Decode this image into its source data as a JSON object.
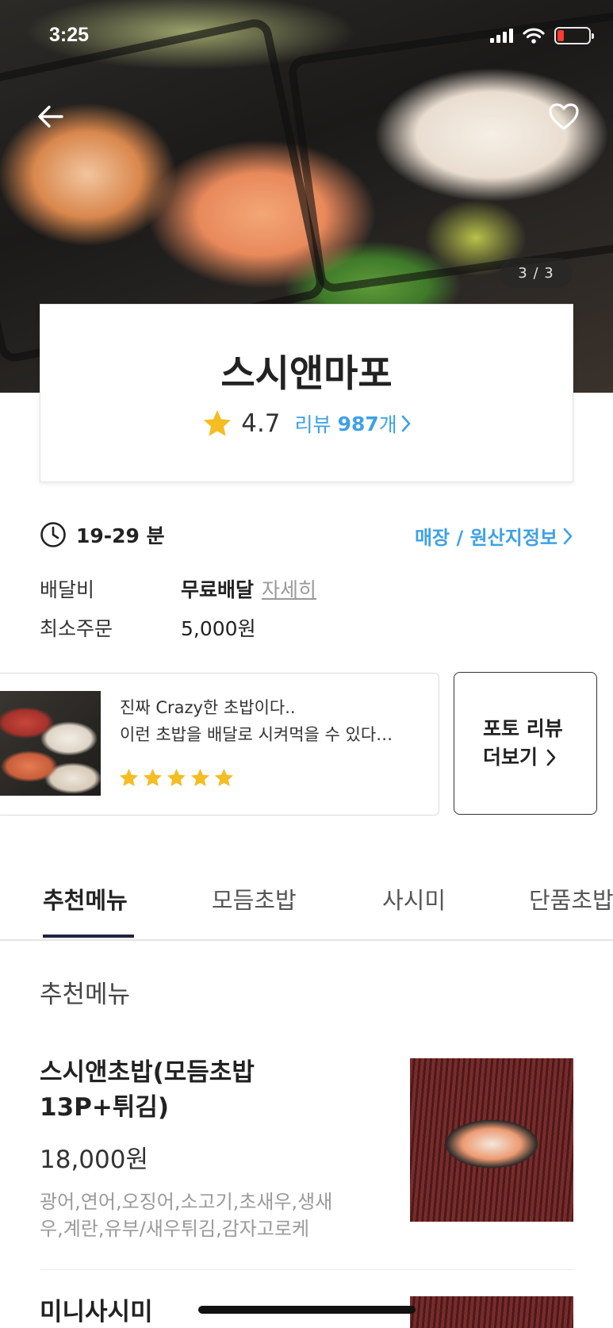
{
  "status_bar": {
    "time": "3:25"
  },
  "hero": {
    "pager": "3 / 3"
  },
  "store": {
    "name": "스시앤마포",
    "rating": "4.7",
    "review_label": "리뷰",
    "review_count": "987",
    "review_unit": "개"
  },
  "info": {
    "delivery_time": "19-29 분",
    "store_link": "매장 / 원산지정보",
    "delivery_fee_label": "배달비",
    "delivery_fee_value": "무료배달",
    "delivery_fee_detail": "자세히",
    "min_order_label": "최소주문",
    "min_order_value": "5,000원"
  },
  "review_preview": {
    "line1": "진짜 Crazy한 초밥이다..",
    "line2": "이런 초밥을 배달로 시켜먹을 수 있다…",
    "stars": 5,
    "photo_more_line1": "포토 리뷰",
    "photo_more_line2": "더보기"
  },
  "tabs": [
    {
      "label": "추천메뉴",
      "active": true
    },
    {
      "label": "모듬초밥",
      "active": false
    },
    {
      "label": "사시미",
      "active": false
    },
    {
      "label": "단품초밥",
      "active": false
    }
  ],
  "section": {
    "title": "추천메뉴"
  },
  "menu": [
    {
      "name_line1": "스시앤초밥(모듬초밥",
      "name_line2": "13P+튀김)",
      "price": "18,000원",
      "desc_line1": "광어,연어,오징어,소고기,초새우,생새",
      "desc_line2": "우,계란,유부/새우튀김,감자고로케"
    },
    {
      "name_line1": "미니사시미"
    }
  ],
  "colors": {
    "accent_blue": "#3ea1e6",
    "star_yellow": "#f5bd23",
    "tab_underline": "#23233a"
  }
}
